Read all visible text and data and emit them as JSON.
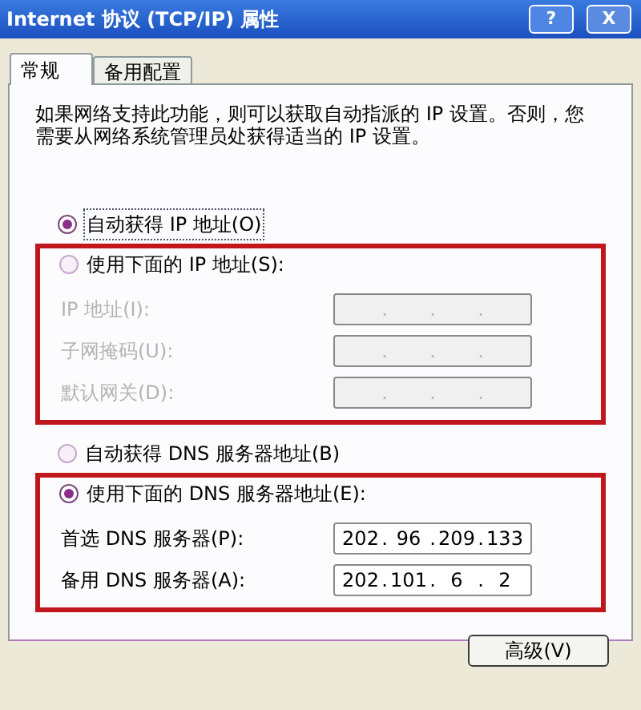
{
  "window": {
    "title": "Internet 协议 (TCP/IP) 属性",
    "buttons": [
      {
        "kind": "help",
        "label": "?"
      },
      {
        "kind": "close",
        "label": "X"
      }
    ]
  },
  "tabs": [
    {
      "label": "常规",
      "selected": true
    },
    {
      "label": "备用配置",
      "selected": false
    }
  ],
  "description": "如果网络支持此功能，则可以获取自动指派的 IP 设置。否则，您需要从网络系统管理员处获得适当的 IP 设置。",
  "ip_section": {
    "auto_option": {
      "label": "自动获得 IP 地址(O)",
      "selected": true
    },
    "manual_option": {
      "label": "使用下面的 IP 地址(S):",
      "selected": false
    },
    "highlighted": true,
    "fields": [
      {
        "label": "IP 地址(I):",
        "disabled": true,
        "separator": "."
      },
      {
        "label": "子网掩码(U):",
        "disabled": true,
        "separator": "."
      },
      {
        "label": "默认网关(D):",
        "disabled": true,
        "separator": "."
      }
    ]
  },
  "dns_section": {
    "auto_option": {
      "label": "自动获得 DNS 服务器地址(B)",
      "selected": false
    },
    "manual_option": {
      "label": "使用下面的 DNS 服务器地址(E):",
      "selected": true
    },
    "highlighted": true,
    "fields": [
      {
        "label": "首选 DNS 服务器(P):",
        "disabled": false,
        "separator": ".",
        "octets": [
          "202",
          "96",
          "209",
          "133"
        ]
      },
      {
        "label": "备用 DNS 服务器(A):",
        "disabled": false,
        "separator": ".",
        "octets": [
          "202",
          "101",
          "6",
          "2"
        ]
      }
    ]
  },
  "advanced_button": "高级(V)"
}
